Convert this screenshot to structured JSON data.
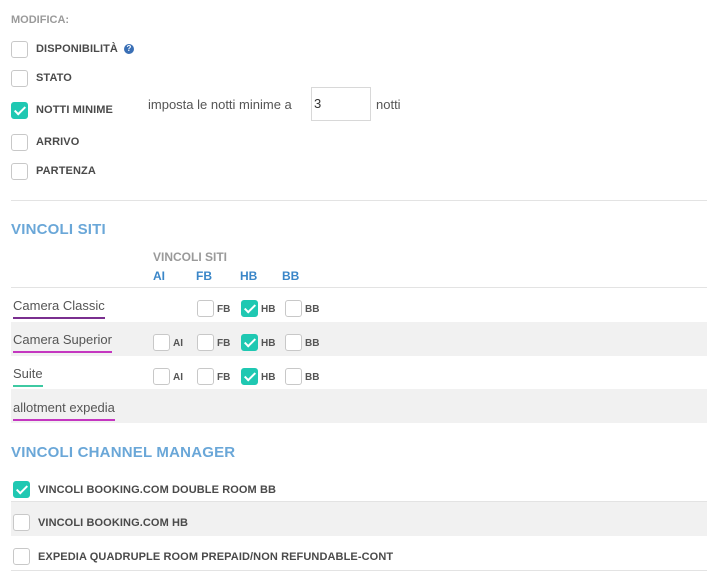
{
  "modifica": {
    "title": "MODIFICA:",
    "options": [
      {
        "label": "DISPONIBILITÀ",
        "checked": false,
        "help_icon": "help-icon"
      },
      {
        "label": "STATO",
        "checked": false
      },
      {
        "label": "NOTTI MINIME",
        "checked": true
      },
      {
        "label": "ARRIVO",
        "checked": false
      },
      {
        "label": "PARTENZA",
        "checked": false
      }
    ],
    "min_nights": {
      "prefix": "imposta le notti minime a",
      "value": "3",
      "suffix": "notti"
    }
  },
  "vincoli_siti": {
    "title": "VINCOLI SITI",
    "subheader": "VINCOLI SITI",
    "columns": [
      "AI",
      "FB",
      "HB",
      "BB"
    ],
    "rows": [
      {
        "name": "Camera Classic",
        "underline_color": "#7a2f8f",
        "options": [
          {
            "label": "FB",
            "checked": false
          },
          {
            "label": "HB",
            "checked": true
          },
          {
            "label": "BB",
            "checked": false
          }
        ]
      },
      {
        "name": "Camera Superior",
        "underline_color": "#c436c0",
        "options": [
          {
            "label": "AI",
            "checked": false
          },
          {
            "label": "FB",
            "checked": false
          },
          {
            "label": "HB",
            "checked": true
          },
          {
            "label": "BB",
            "checked": false
          }
        ]
      },
      {
        "name": "Suite",
        "underline_color": "#3ec9a2",
        "options": [
          {
            "label": "AI",
            "checked": false
          },
          {
            "label": "FB",
            "checked": false
          },
          {
            "label": "HB",
            "checked": true
          },
          {
            "label": "BB",
            "checked": false
          }
        ]
      },
      {
        "name": "allotment expedia",
        "underline_color": "#c436c0",
        "options": []
      }
    ]
  },
  "channel_manager": {
    "title": "VINCOLI CHANNEL MANAGER",
    "items": [
      {
        "label": "VINCOLI BOOKING.COM DOUBLE ROOM BB",
        "checked": true
      },
      {
        "label": "VINCOLI BOOKING.COM HB",
        "checked": false
      },
      {
        "label": "EXPEDIA QUADRUPLE ROOM PREPAID/NON REFUNDABLE-CONT",
        "checked": false
      }
    ]
  },
  "colors": {
    "accent": "#1fc8b2",
    "section_title": "#6aa7d8",
    "column_head": "#3a86c8"
  }
}
